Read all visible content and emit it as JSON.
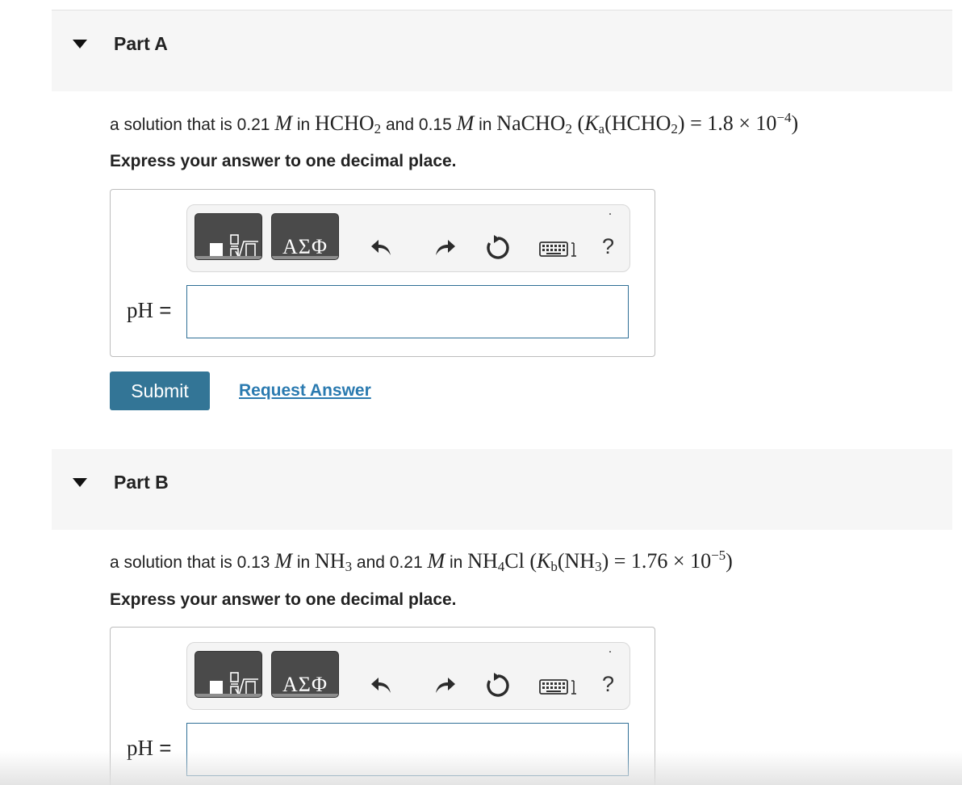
{
  "parts": [
    {
      "title": "Part A",
      "question": {
        "prefix": "a solution that is ",
        "conc1": "0.21",
        "unit": "M",
        "in1": " in ",
        "acid_base": "HCHO",
        "acid_sub": "2",
        "and": " and ",
        "conc2": "0.15",
        "in2": " in ",
        "salt": "NaCHO",
        "salt_sub": "2",
        "k_symbol": "K",
        "k_sub": "a",
        "k_species": "HCHO",
        "k_species_sub": "2",
        "k_value": "1.8 × 10",
        "k_exp": "−4"
      },
      "instruction": "Express your answer to one decimal place.",
      "toolbar": {
        "greek_label": "ΑΣΦ",
        "help_label": "?"
      },
      "answer_label": "pH",
      "equals": "=",
      "answer_value": "",
      "submit_label": "Submit",
      "request_label": "Request Answer"
    },
    {
      "title": "Part B",
      "question": {
        "prefix": "a solution that is ",
        "conc1": "0.13",
        "unit": "M",
        "in1": " in ",
        "acid_base": "NH",
        "acid_sub": "3",
        "and": " and ",
        "conc2": "0.21",
        "in2": " in ",
        "salt": "NH",
        "salt_sub": "4",
        "salt_tail": "Cl",
        "k_symbol": "K",
        "k_sub": "b",
        "k_species": "NH",
        "k_species_sub": "3",
        "k_value": "1.76 × 10",
        "k_exp": "−5"
      },
      "instruction": "Express your answer to one decimal place.",
      "toolbar": {
        "greek_label": "ΑΣΦ",
        "help_label": "?"
      },
      "answer_label": "pH",
      "equals": "=",
      "answer_value": ""
    }
  ],
  "colors": {
    "submit": "#337596",
    "link": "#2a7ab0",
    "input_border": "#2f6f96",
    "header_bg": "#f6f6f6"
  }
}
